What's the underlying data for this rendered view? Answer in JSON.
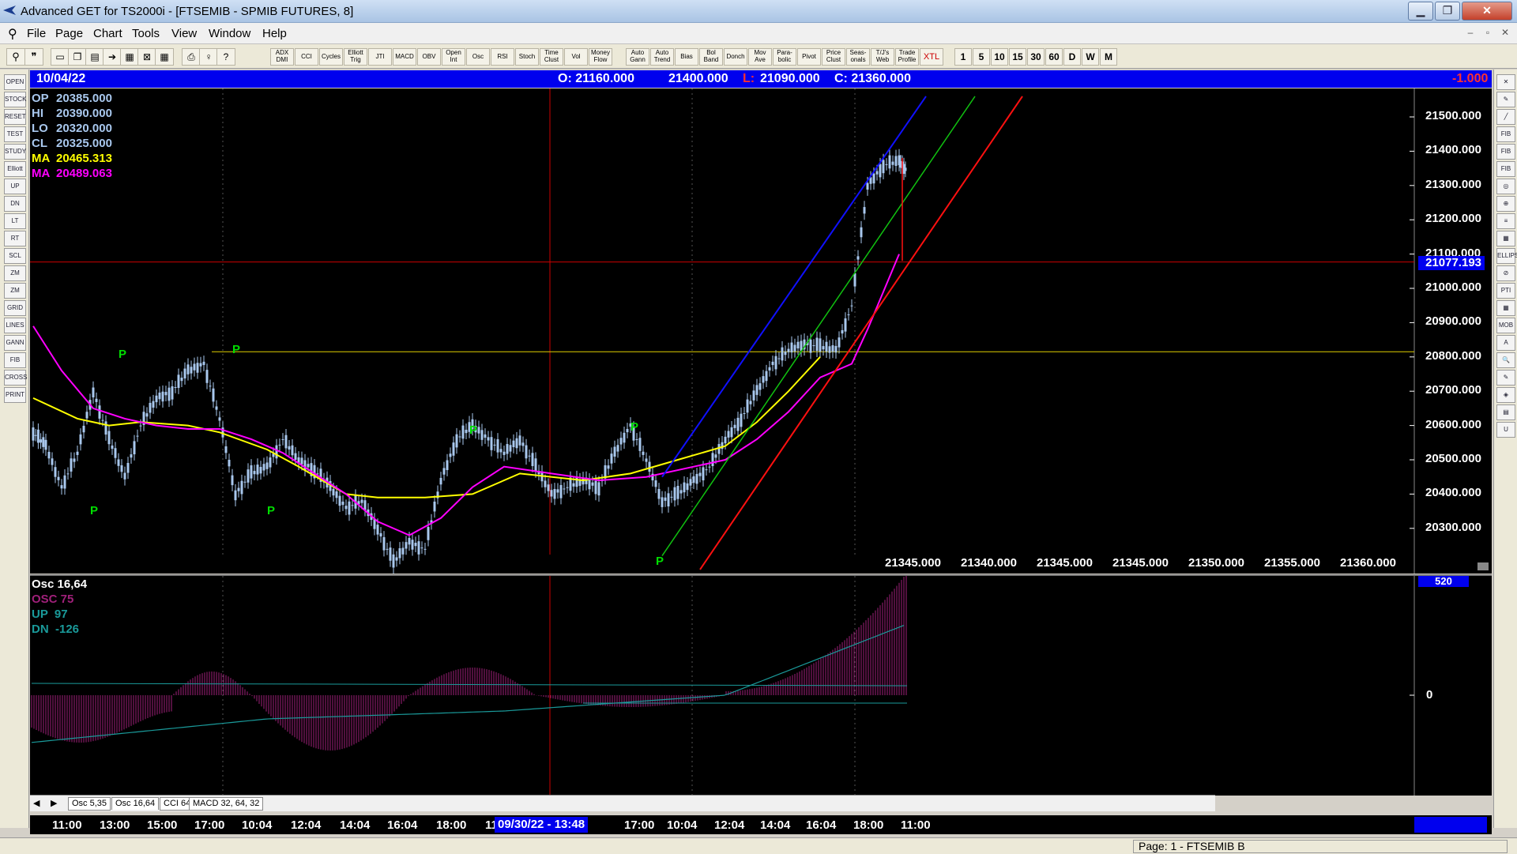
{
  "window": {
    "title": "Advanced GET for TS2000i - [FTSEMIB - SPMIB FUTURES, 8]",
    "minimize": "▁",
    "maximize": "❐",
    "close": "✕"
  },
  "menu": {
    "items": [
      "File",
      "Page",
      "Chart",
      "Tools",
      "View",
      "Window",
      "Help"
    ],
    "mdi_min": "–",
    "mdi_max": "▫",
    "mdi_close": "✕"
  },
  "toolbar": {
    "study_buttons": [
      "ADX DMI",
      "CCI",
      "Cycles",
      "Elliott Trig",
      "JTI",
      "MACD",
      "OBV",
      "Open Int",
      "Osc",
      "RSI",
      "Stoch",
      "Time Clust",
      "Vol",
      "Money Flow",
      "Auto Gann",
      "Auto Trend",
      "Bias",
      "Bol Band",
      "Donch",
      "Mov Ave",
      "Para-bolic",
      "Pivot",
      "Price Clust",
      "Seas-onals",
      "T/J's Web",
      "Trade Profile",
      "XTL"
    ],
    "period_buttons": [
      "1",
      "5",
      "10",
      "15",
      "30",
      "60",
      "D",
      "W",
      "M"
    ]
  },
  "left_tools": [
    "OPEN",
    "STOCK",
    "RESET",
    "TEST",
    "STUDY",
    "Elliott",
    "UP",
    "DN",
    "LT",
    "RT",
    "SCL",
    "ZM",
    "ZM",
    "GRID",
    "LINES",
    "GANN",
    "FIB",
    "CROSS",
    "PRINT"
  ],
  "right_tools": [
    "✕",
    "✎",
    "╱",
    "FIB RET",
    "FIB EXT",
    "FIB TIME",
    "◎",
    "⊕",
    "≡",
    "▦",
    "ELLIPS",
    "⊘",
    "PTI",
    "▦",
    "MOB",
    "A",
    "🔍",
    "✎",
    "◈",
    "▤",
    "U"
  ],
  "header": {
    "date": "10/04/22",
    "open": "O: 21160.000",
    "high": "21400.000",
    "low_label": "L:",
    "low": "21090.000",
    "close": "C: 21360.000",
    "change": "-1.000"
  },
  "price_info": {
    "op": {
      "label": "OP",
      "value": "20385.000"
    },
    "hi": {
      "label": "HI",
      "value": "20390.000"
    },
    "lo": {
      "label": "LO",
      "value": "20320.000"
    },
    "cl": {
      "label": "CL",
      "value": "20325.000"
    },
    "ma1": {
      "label": "MA",
      "value": "20465.313"
    },
    "ma2": {
      "label": "MA",
      "value": "20489.063"
    }
  },
  "price_axis": {
    "ticks": [
      "21500.000",
      "21400.000",
      "21300.000",
      "21200.000",
      "21100.000",
      "21000.000",
      "20900.000",
      "20800.000",
      "20700.000",
      "20600.000",
      "20500.000",
      "20400.000",
      "20300.000"
    ],
    "cursor_value": "21077.193"
  },
  "bottom_values": [
    "21345.000",
    "21340.000",
    "21345.000",
    "21345.000",
    "21350.000",
    "21355.000",
    "21360.000"
  ],
  "pivot_marker": "P",
  "oscillator": {
    "title": "Osc 16,64",
    "osc": "OSC 75",
    "up": "UP  97",
    "dn": "DN  -126",
    "zero_label": "0",
    "top_label": "520"
  },
  "tabs": [
    "Osc 5,35",
    "Osc 16,64",
    "CCI 64",
    "MACD 32, 64, 32"
  ],
  "time_axis": {
    "labels": [
      "11:00",
      "13:00",
      "15:00",
      "17:00",
      "10:04",
      "12:04",
      "14:04",
      "16:04",
      "18:00",
      "11",
      "00",
      "17:00",
      "10:04",
      "12:04",
      "14:04",
      "16:04",
      "18:00",
      "11:00"
    ],
    "cursor": "09/30/22 - 13:48"
  },
  "status": {
    "page": "Page: 1 - FTSEMIB B"
  },
  "colors": {
    "header_bg": "#0000ee",
    "ma_yellow": "#ffff00",
    "ma_magenta": "#ff00ff",
    "pivot_green": "#00dd00",
    "candle": "#a9c8ee",
    "osc_hist": "#a0207a",
    "osc_line": "#1a9a9a"
  }
}
